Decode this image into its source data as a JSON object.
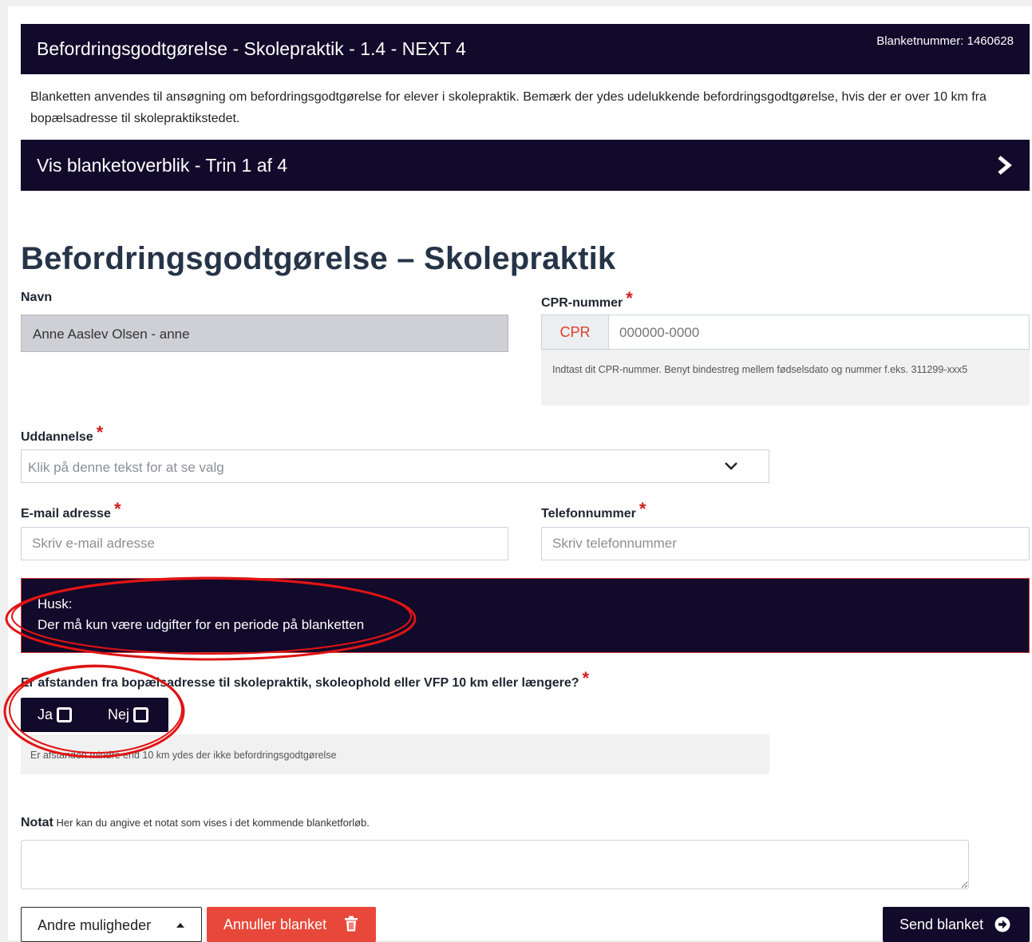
{
  "header": {
    "title": "Befordringsgodtgørelse - Skolepraktik - 1.4 - NEXT 4",
    "form_number": "Blanketnummer: 1460628"
  },
  "intro": "Blanketten anvendes til ansøgning om befordringsgodtgørelse for elever i skolepraktik. Bemærk der ydes udelukkende befordringsgodtgørelse, hvis der er over 10 km fra bopælsadresse til skolepraktikstedet.",
  "overview": {
    "label": "Vis blanketoverblik - Trin 1 af 4",
    "icon": "chevron-right-icon"
  },
  "page_title": "Befordringsgodtgørelse – Skolepraktik",
  "fields": {
    "name": {
      "label": "Navn",
      "value": "Anne Aaslev Olsen - anne"
    },
    "cpr": {
      "label": "CPR-nummer",
      "required_mark": "*",
      "addon": "CPR",
      "placeholder": "000000-0000",
      "help": "Indtast dit CPR-nummer. Benyt bindestreg mellem fødselsdato og nummer f.eks. 311299-xxx5"
    },
    "education": {
      "label": "Uddannelse",
      "required_mark": "*",
      "placeholder": "Klik på denne tekst for at se valg"
    },
    "email": {
      "label": "E-mail adresse",
      "required_mark": "*",
      "placeholder": "Skriv e-mail adresse"
    },
    "phone": {
      "label": "Telefonnummer",
      "required_mark": "*",
      "placeholder": "Skriv telefonnummer"
    }
  },
  "notice": {
    "line1": "Husk:",
    "line2": "Der må kun være udgifter for en periode på blanketten"
  },
  "distance_question": {
    "label": "Er afstanden fra bopælsadresse til skolepraktik, skoleophold eller VFP 10 km eller længere?",
    "required_mark": "*",
    "options": [
      {
        "label": "Ja",
        "checked": false
      },
      {
        "label": "Nej",
        "checked": false
      }
    ],
    "help": "Er afstanden mindre end 10 km ydes der ikke befordringsgodtgørelse"
  },
  "note": {
    "label": "Notat",
    "hint": "Her kan du angive et notat som vises i det kommende blanketforløb.",
    "value": ""
  },
  "buttons": {
    "other": "Andre muligheder",
    "cancel": "Annuller blanket",
    "send": "Send blanket"
  },
  "colors": {
    "dark_navy": "#110a2a",
    "required_red": "#d01c1c",
    "cancel_red": "#e8483a",
    "annotation_red": "#e01414"
  }
}
